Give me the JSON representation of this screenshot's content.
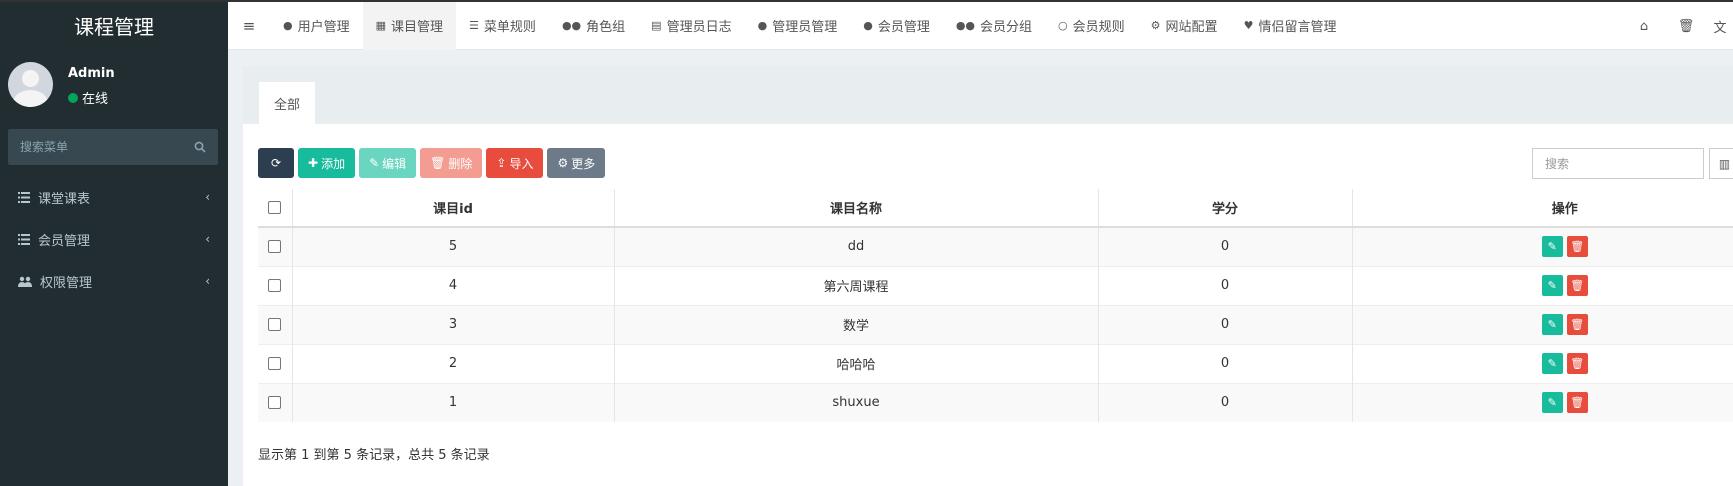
{
  "sidebar": {
    "logo": "课程管理",
    "user_name": "Admin",
    "user_status": "在线",
    "search_placeholder": "搜索菜单",
    "items": [
      {
        "label": "课堂课表",
        "icon": "list-icon"
      },
      {
        "label": "会员管理",
        "icon": "list-icon"
      },
      {
        "label": "权限管理",
        "icon": "users-icon"
      }
    ]
  },
  "navbar": {
    "tabs": [
      {
        "label": "用户管理",
        "icon": "user-icon"
      },
      {
        "label": "课目管理",
        "icon": "calendar-icon"
      },
      {
        "label": "菜单规则",
        "icon": "bars-icon"
      },
      {
        "label": "角色组",
        "icon": "group-icon"
      },
      {
        "label": "管理员日志",
        "icon": "list-alt-icon"
      },
      {
        "label": "管理员管理",
        "icon": "user-icon"
      },
      {
        "label": "会员管理",
        "icon": "user-icon"
      },
      {
        "label": "会员分组",
        "icon": "group-icon"
      },
      {
        "label": "会员规则",
        "icon": "circle-icon"
      },
      {
        "label": "网站配置",
        "icon": "cogs-icon"
      },
      {
        "label": "情侣留言管理",
        "icon": "heart-icon"
      }
    ],
    "active_tab": "课目管理"
  },
  "content": {
    "tab_all": "全部",
    "toolbar": {
      "add": "添加",
      "edit": "编辑",
      "delete": "删除",
      "import": "导入",
      "more": "更多"
    },
    "search_placeholder": "搜索",
    "table": {
      "headers": [
        "课目id",
        "课目名称",
        "学分",
        "操作"
      ],
      "rows": [
        {
          "id": "5",
          "name": "dd",
          "credit": "0"
        },
        {
          "id": "4",
          "name": "第六周课程",
          "credit": "0"
        },
        {
          "id": "3",
          "name": "数学",
          "credit": "0"
        },
        {
          "id": "2",
          "name": "哈哈哈",
          "credit": "0"
        },
        {
          "id": "1",
          "name": "shuxue",
          "credit": "0"
        }
      ]
    },
    "footer": "显示第 1 到第 5 条记录，总共 5 条记录"
  },
  "colors": {
    "sidebar_bg": "#222d32",
    "accent_green": "#18bc9c",
    "danger_red": "#e74c3c",
    "dark": "#2c3e50"
  }
}
